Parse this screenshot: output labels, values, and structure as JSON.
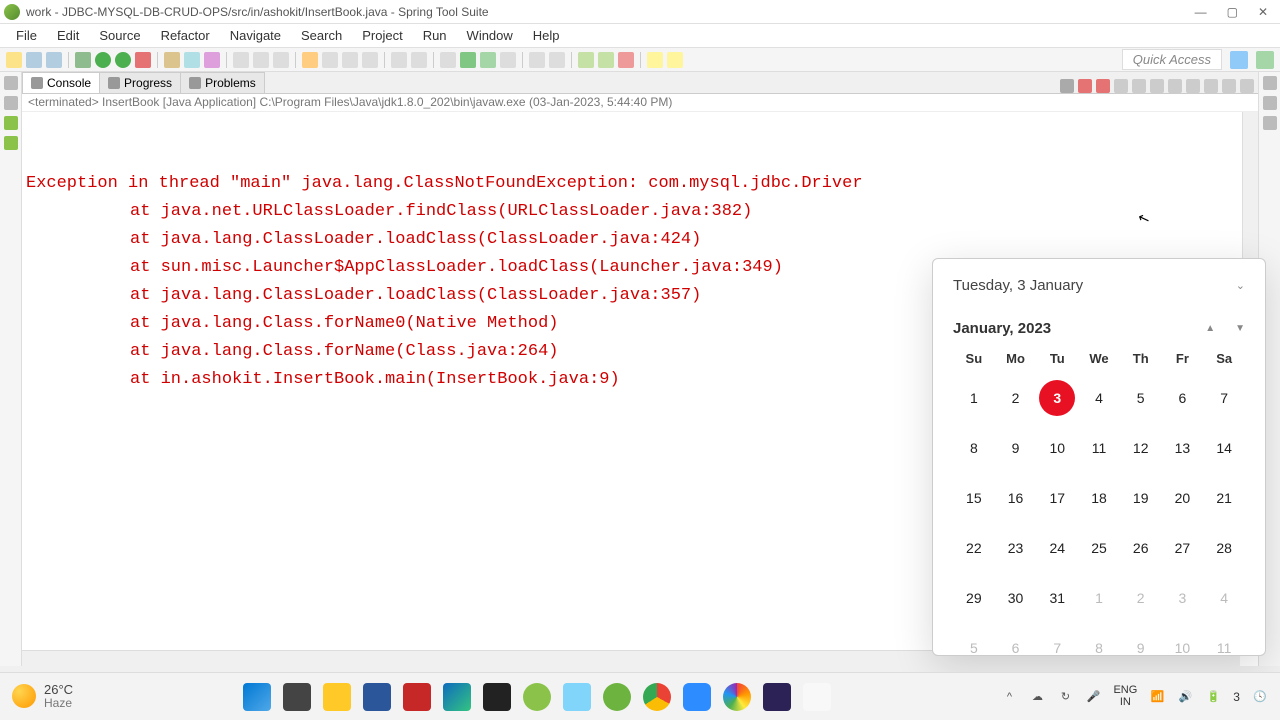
{
  "window": {
    "title": "work - JDBC-MYSQL-DB-CRUD-OPS/src/in/ashokit/InsertBook.java - Spring Tool Suite"
  },
  "menu": [
    "File",
    "Edit",
    "Source",
    "Refactor",
    "Navigate",
    "Search",
    "Project",
    "Run",
    "Window",
    "Help"
  ],
  "quick_access": "Quick Access",
  "view_tabs": [
    {
      "label": "Console",
      "active": true
    },
    {
      "label": "Progress",
      "active": false
    },
    {
      "label": "Problems",
      "active": false
    }
  ],
  "console_status": "<terminated> InsertBook [Java Application] C:\\Program Files\\Java\\jdk1.8.0_202\\bin\\javaw.exe (03-Jan-2023, 5:44:40 PM)",
  "console_lines": [
    "Exception in thread \"main\" java.lang.ClassNotFoundException: com.mysql.jdbc.Driver",
    "at java.net.URLClassLoader.findClass(URLClassLoader.java:382)",
    "at java.lang.ClassLoader.loadClass(ClassLoader.java:424)",
    "at sun.misc.Launcher$AppClassLoader.loadClass(Launcher.java:349)",
    "at java.lang.ClassLoader.loadClass(ClassLoader.java:357)",
    "at java.lang.Class.forName0(Native Method)",
    "at java.lang.Class.forName(Class.java:264)",
    "at in.ashokit.InsertBook.main(InsertBook.java:9)"
  ],
  "weather": {
    "temp": "26°C",
    "desc": "Haze"
  },
  "tray": {
    "lang1": "ENG",
    "lang2": "IN",
    "badge": "3"
  },
  "calendar": {
    "header_date": "Tuesday, 3 January",
    "month_label": "January, 2023",
    "dow": [
      "Su",
      "Mo",
      "Tu",
      "We",
      "Th",
      "Fr",
      "Sa"
    ],
    "weeks": [
      [
        {
          "d": "1"
        },
        {
          "d": "2"
        },
        {
          "d": "3",
          "today": true
        },
        {
          "d": "4"
        },
        {
          "d": "5"
        },
        {
          "d": "6"
        },
        {
          "d": "7"
        }
      ],
      [
        {
          "d": "8"
        },
        {
          "d": "9"
        },
        {
          "d": "10"
        },
        {
          "d": "11"
        },
        {
          "d": "12"
        },
        {
          "d": "13"
        },
        {
          "d": "14"
        }
      ],
      [
        {
          "d": "15"
        },
        {
          "d": "16"
        },
        {
          "d": "17"
        },
        {
          "d": "18"
        },
        {
          "d": "19"
        },
        {
          "d": "20"
        },
        {
          "d": "21"
        }
      ],
      [
        {
          "d": "22"
        },
        {
          "d": "23"
        },
        {
          "d": "24"
        },
        {
          "d": "25"
        },
        {
          "d": "26"
        },
        {
          "d": "27"
        },
        {
          "d": "28"
        }
      ],
      [
        {
          "d": "29"
        },
        {
          "d": "30"
        },
        {
          "d": "31"
        },
        {
          "d": "1",
          "other": true
        },
        {
          "d": "2",
          "other": true
        },
        {
          "d": "3",
          "other": true
        },
        {
          "d": "4",
          "other": true
        }
      ],
      [
        {
          "d": "5",
          "other": true
        },
        {
          "d": "6",
          "other": true
        },
        {
          "d": "7",
          "other": true
        },
        {
          "d": "8",
          "other": true
        },
        {
          "d": "9",
          "other": true
        },
        {
          "d": "10",
          "other": true
        },
        {
          "d": "11",
          "other": true
        }
      ]
    ]
  }
}
